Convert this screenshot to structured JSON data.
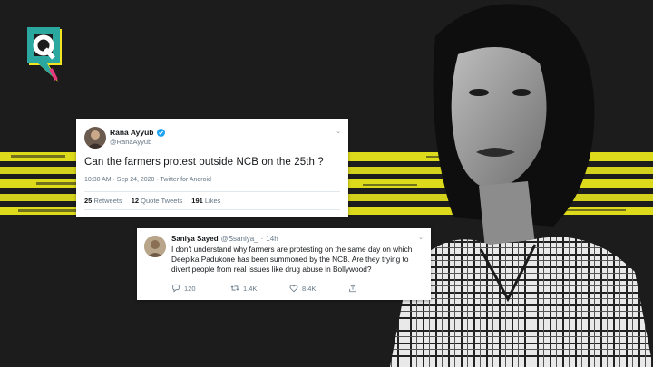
{
  "colors": {
    "background": "#1c1c1c",
    "stripe": "#e8e51c",
    "logo_teal": "#2aa8a0",
    "logo_yellow": "#f3e51f",
    "logo_pink": "#e6397a",
    "twitter_blue": "#1da1f2"
  },
  "logo": {
    "icon": "the-quint-logo"
  },
  "tweet1": {
    "name": "Rana Ayyub",
    "handle": "@RanaAyyub",
    "text": "Can the farmers protest outside NCB on the 25th ?",
    "meta": "10:30 AM · Sep 24, 2020 · Twitter for Android",
    "retweets_count": "25",
    "retweets_label": "Retweets",
    "quotes_count": "12",
    "quotes_label": "Quote Tweets",
    "likes_count": "191",
    "likes_label": "Likes"
  },
  "tweet2": {
    "name": "Saniya Sayed",
    "handle": "@Ssaniya_",
    "dot": "·",
    "time": "14h",
    "text": "I don't understand why farmers are protesting on the same day on which Deepika Padukone has been summoned by the NCB. Are they trying to divert people from real issues like drug abuse in Bollywood?",
    "actions": {
      "reply_count": "120",
      "retweet_count": "1.4K",
      "like_count": "8.4K",
      "share_count": ""
    }
  }
}
